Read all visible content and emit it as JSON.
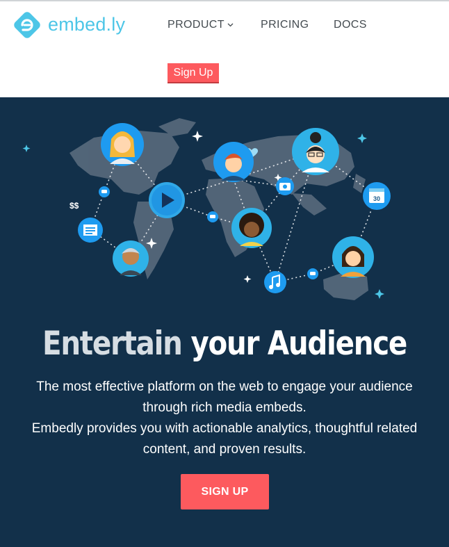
{
  "header": {
    "logo_text": "embed.ly",
    "nav": {
      "product": "PRODUCT",
      "pricing": "PRICING",
      "docs": "DOCS"
    },
    "signup_label": "Sign Up"
  },
  "hero": {
    "title_part1": "Entertain",
    "title_part2": "your Audience",
    "line1": "The most effective platform on the web to engage your audience through rich media embeds.",
    "line2": "Embedly provides you with actionable analytics, thoughtful related content, and proven results.",
    "cta_label": "SIGN UP",
    "calendar_day": "30",
    "currency_symbol": "$$"
  },
  "colors": {
    "brand": "#4dc6e7",
    "hero_bg": "#12304a",
    "cta": "#fd5a5e",
    "node": "#1e9bf0"
  },
  "icons": [
    "logo-icon",
    "chevron-down-icon",
    "play-icon",
    "camera-icon",
    "calendar-icon",
    "music-icon",
    "document-icon",
    "heart-icon",
    "dollar-icon",
    "chat-icon",
    "sparkle-icon"
  ]
}
